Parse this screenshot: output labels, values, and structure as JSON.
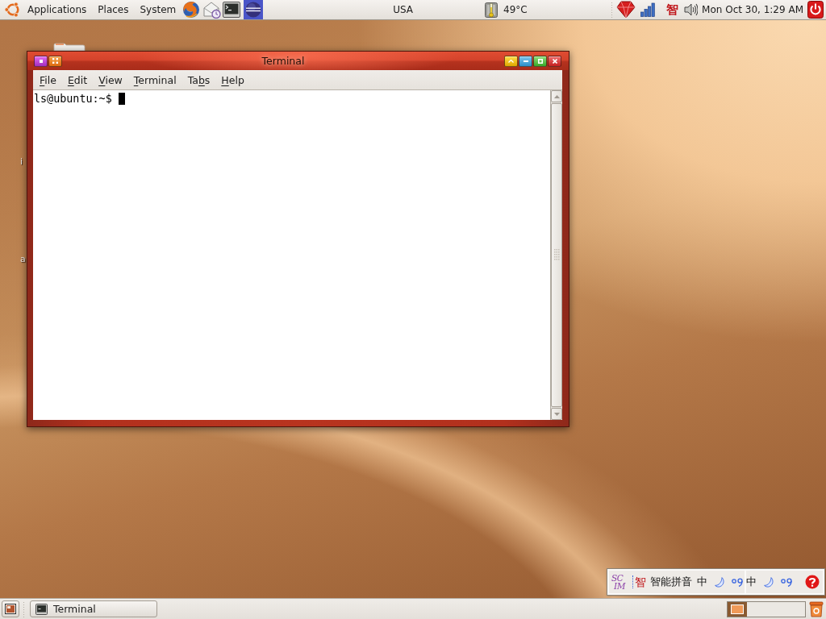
{
  "top_panel": {
    "menus": [
      {
        "label": "Applications"
      },
      {
        "label": "Places"
      },
      {
        "label": "System"
      }
    ],
    "keyboard_layout": "USA",
    "cpu_temperature": "49°C",
    "input_method_indicator": "智",
    "clock": "Mon Oct 30, 1:29 AM"
  },
  "desktop_icons": [
    {
      "label": "i"
    },
    {
      "label": "a"
    }
  ],
  "terminal_window": {
    "title": "Terminal",
    "focused": true,
    "menu": [
      {
        "parts": [
          {
            "text": "F",
            "underlined": true
          },
          {
            "text": "ile",
            "underlined": false
          }
        ]
      },
      {
        "parts": [
          {
            "text": "E",
            "underlined": true
          },
          {
            "text": "dit",
            "underlined": false
          }
        ]
      },
      {
        "parts": [
          {
            "text": "V",
            "underlined": true
          },
          {
            "text": "iew",
            "underlined": false
          }
        ]
      },
      {
        "parts": [
          {
            "text": "T",
            "underlined": true
          },
          {
            "text": "erminal",
            "underlined": false
          }
        ]
      },
      {
        "parts": [
          {
            "text": "Ta",
            "underlined": false
          },
          {
            "text": "b",
            "underlined": true
          },
          {
            "text": "s",
            "underlined": false
          }
        ]
      },
      {
        "parts": [
          {
            "text": "H",
            "underlined": true
          },
          {
            "text": "elp",
            "underlined": false
          }
        ]
      }
    ],
    "prompt": "ls@ubuntu:~$"
  },
  "input_method_panel": {
    "logo": [
      "SC",
      "IM"
    ],
    "engine_icon": "智",
    "engine": "智能拼音",
    "status_groups": [
      {
        "mode": "中"
      },
      {
        "mode": "中"
      }
    ]
  },
  "bottom_panel": {
    "tasks": [
      {
        "label": "Terminal",
        "selected": false
      }
    ],
    "workspaces": [
      {
        "selected": true,
        "has_window": true
      },
      {
        "selected": false,
        "has_window": false
      },
      {
        "selected": false,
        "has_window": false
      },
      {
        "selected": false,
        "has_window": false
      }
    ]
  }
}
